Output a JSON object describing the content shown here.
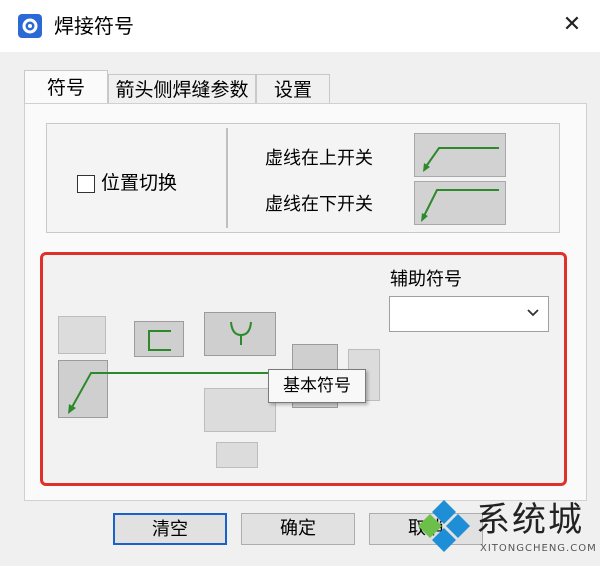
{
  "window": {
    "title": "焊接符号",
    "close_glyph": "✕",
    "icon": "gear-icon"
  },
  "tabs": [
    {
      "label": "符号",
      "active": true
    },
    {
      "label": "箭头侧焊缝参数",
      "active": false
    },
    {
      "label": "设置",
      "active": false
    }
  ],
  "symbol_tab": {
    "position_toggle_label": "位置切换",
    "position_toggle_checked": false,
    "dashed_top_label": "虚线在上开关",
    "dashed_bottom_label": "虚线在下开关",
    "auxiliary_symbol_label": "辅助符号",
    "auxiliary_symbol_value": "",
    "tooltip": "基本符号"
  },
  "buttons": {
    "clear": "清空",
    "ok": "确定",
    "cancel": "取消"
  },
  "watermark": {
    "text": "系统城",
    "subtext": "XITONGCHENG.COM"
  },
  "colors": {
    "accent": "#1a62c9",
    "highlight_border": "#e0302b",
    "symbol_green": "#2c8a2c",
    "watermark_blue": "#1e8fd6"
  }
}
